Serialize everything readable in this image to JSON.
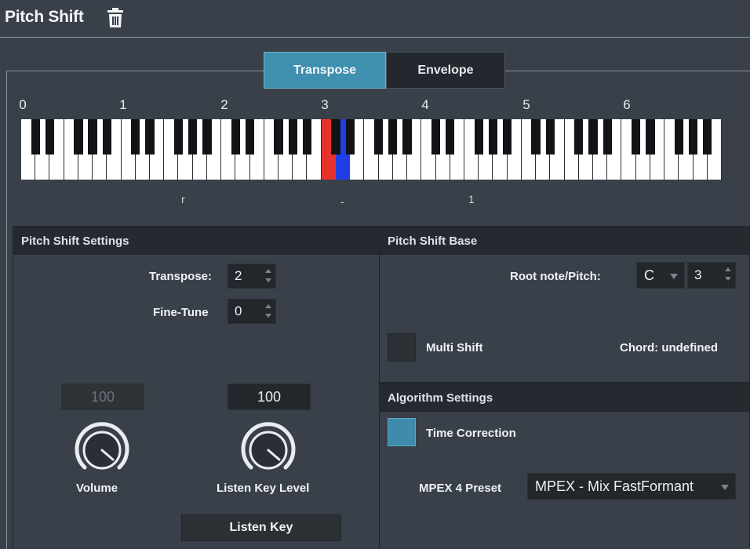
{
  "header": {
    "title": "Pitch Shift"
  },
  "tabs": [
    {
      "label": "Transpose",
      "active": true
    },
    {
      "label": "Envelope",
      "active": false
    }
  ],
  "keyboard": {
    "octave_labels": [
      "0",
      "1",
      "2",
      "3",
      "4",
      "5",
      "6"
    ],
    "white_key_count": 49,
    "highlight_root_color": "#e8322c",
    "highlight_target_color": "#1f3ee6",
    "range_marks": [
      "r",
      "-",
      "1"
    ]
  },
  "pitch_shift_settings": {
    "title": "Pitch Shift Settings",
    "transpose_label": "Transpose:",
    "transpose_value": "2",
    "finetune_label": "Fine-Tune",
    "finetune_value": "0",
    "volume_value": "100",
    "volume_label": "Volume",
    "listen_level_value": "100",
    "listen_level_label": "Listen Key Level",
    "listen_key_button": "Listen Key"
  },
  "pitch_shift_base": {
    "title": "Pitch Shift Base",
    "root_label": "Root note/Pitch:",
    "root_note": "C",
    "root_octave": "3",
    "multi_shift_label": "Multi Shift",
    "chord_text": "Chord: undefined"
  },
  "algorithm_settings": {
    "title": "Algorithm Settings",
    "time_correction_label": "Time Correction",
    "preset_label": "MPEX 4 Preset",
    "preset_value": "MPEX - Mix FastFormant"
  },
  "colors": {
    "accent": "#3f8fae",
    "background": "#3a4049",
    "panel_header": "#252a30"
  }
}
